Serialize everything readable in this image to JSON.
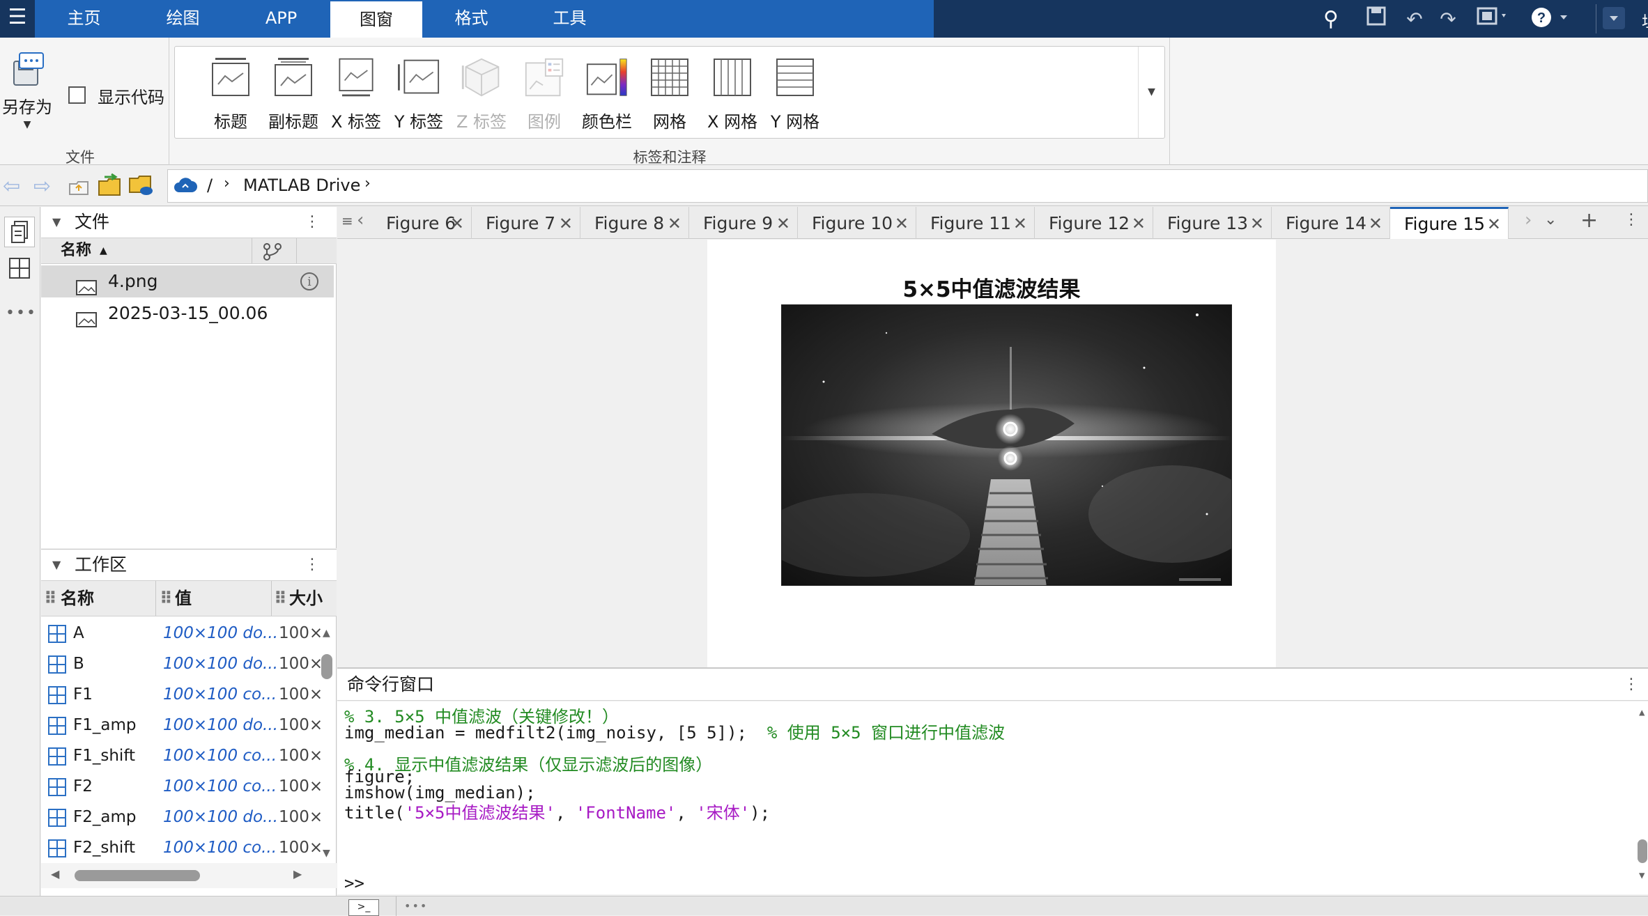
{
  "toolbar": {
    "tabs": [
      "主页",
      "绘图",
      "APP",
      "图窗",
      "格式",
      "工具"
    ],
    "active_tab": "图窗"
  },
  "ribbon": {
    "file": {
      "save_as_label": "另存为",
      "show_code_label": "显示代码",
      "show_code_checked": false,
      "section_label": "文件"
    },
    "annotations": {
      "buttons": [
        {
          "label": "标题",
          "icon": "title-icon",
          "enabled": true
        },
        {
          "label": "副标题",
          "icon": "subtitle-icon",
          "enabled": true
        },
        {
          "label": "X 标签",
          "icon": "x-label-icon",
          "enabled": true
        },
        {
          "label": "Y 标签",
          "icon": "y-label-icon",
          "enabled": true
        },
        {
          "label": "Z 标签",
          "icon": "z-label-icon",
          "enabled": false
        },
        {
          "label": "图例",
          "icon": "legend-icon",
          "enabled": false
        },
        {
          "label": "颜色栏",
          "icon": "colorbar-icon",
          "enabled": true
        },
        {
          "label": "网格",
          "icon": "grid-icon",
          "enabled": true
        },
        {
          "label": "X 网格",
          "icon": "x-grid-icon",
          "enabled": true
        },
        {
          "label": "Y 网格",
          "icon": "y-grid-icon",
          "enabled": true
        }
      ],
      "section_label": "标签和注释"
    }
  },
  "address": {
    "root": "/",
    "path": "MATLAB Drive"
  },
  "file_panel": {
    "title": "文件",
    "column_name": "名称",
    "files": [
      {
        "name": "4.png",
        "selected": true
      },
      {
        "name": "2025-03-15_00.06",
        "selected": false
      }
    ]
  },
  "workspace": {
    "title": "工作区",
    "columns": [
      "名称",
      "值",
      "大小"
    ],
    "rows": [
      {
        "name": "A",
        "value": "100×100 do...",
        "size": "100×"
      },
      {
        "name": "B",
        "value": "100×100 do...",
        "size": "100×"
      },
      {
        "name": "F1",
        "value": "100×100 co...",
        "size": "100×"
      },
      {
        "name": "F1_amp",
        "value": "100×100 do...",
        "size": "100×"
      },
      {
        "name": "F1_shift",
        "value": "100×100 co...",
        "size": "100×"
      },
      {
        "name": "F2",
        "value": "100×100 co...",
        "size": "100×"
      },
      {
        "name": "F2_amp",
        "value": "100×100 do...",
        "size": "100×"
      },
      {
        "name": "F2_shift",
        "value": "100×100 co...",
        "size": "100×"
      }
    ]
  },
  "figure_tabs": [
    "Figure 6",
    "Figure 7",
    "Figure 8",
    "Figure 9",
    "Figure 10",
    "Figure 11",
    "Figure 12",
    "Figure 13",
    "Figure 14",
    "Figure 15"
  ],
  "active_figure": "Figure 15",
  "figure": {
    "title": "5×5中值滤波结果"
  },
  "command_window": {
    "title": "命令行窗口",
    "lines": [
      {
        "parts": [
          {
            "t": "% 3. 5×5 中值滤波（关键修改！）",
            "c": "cmt"
          }
        ]
      },
      {
        "parts": [
          {
            "t": "img_median = medfilt2(img_noisy, [5 5]);  ",
            "c": ""
          },
          {
            "t": "% 使用 5×5 窗口进行中值滤波",
            "c": "cmt"
          }
        ]
      },
      {
        "parts": []
      },
      {
        "parts": [
          {
            "t": "% 4. 显示中值滤波结果（仅显示滤波后的图像）",
            "c": "cmt"
          }
        ]
      },
      {
        "parts": [
          {
            "t": "figure;",
            "c": ""
          }
        ]
      },
      {
        "parts": [
          {
            "t": "imshow(img_median);",
            "c": ""
          }
        ]
      },
      {
        "parts": [
          {
            "t": "title(",
            "c": ""
          },
          {
            "t": "'5×5中值滤波结果'",
            "c": "str"
          },
          {
            "t": ", ",
            "c": ""
          },
          {
            "t": "'FontName'",
            "c": "str"
          },
          {
            "t": ", ",
            "c": ""
          },
          {
            "t": "'宋体'",
            "c": "str"
          },
          {
            "t": ");",
            "c": ""
          }
        ]
      }
    ],
    "prompt": ">>"
  },
  "colors": {
    "topbar": "#16355e",
    "tab_blue": "#1f64b7",
    "comment": "#228b22",
    "string": "#a71ac4"
  }
}
